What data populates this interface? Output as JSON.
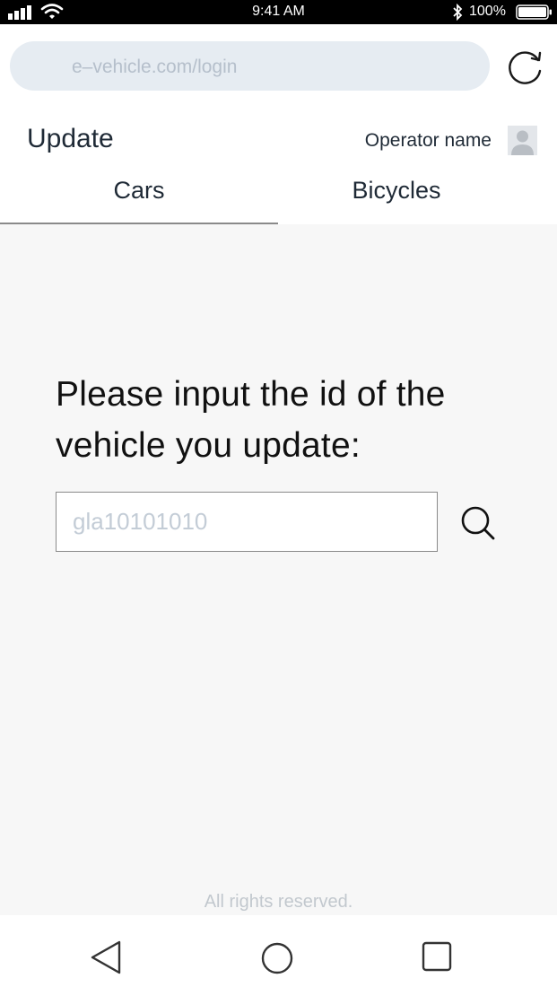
{
  "status_bar": {
    "time": "9:41 AM",
    "battery_percent": "100%",
    "icons": [
      "signal-icon",
      "wifi-icon",
      "bluetooth-icon",
      "battery-icon"
    ]
  },
  "browser": {
    "url": "e–vehicle.com/login",
    "reload_icon": "reload-icon"
  },
  "header": {
    "title": "Update",
    "operator_name": "Operator name",
    "avatar_icon": "user-avatar-icon"
  },
  "tabs": [
    {
      "label": "Cars",
      "active": true
    },
    {
      "label": "Bicycles",
      "active": false
    }
  ],
  "main": {
    "prompt": "Please input the id of the vehicle you update:",
    "vehicle_id_input": {
      "value": "",
      "placeholder": "gla10101010"
    },
    "search_icon": "search-icon",
    "footer": "All rights reserved."
  },
  "nav_bar": {
    "icons": [
      "back-icon",
      "home-icon",
      "recent-apps-icon"
    ]
  },
  "colors": {
    "status_bar": "#000000",
    "address_bar": "#e6ecf2",
    "main_background": "#f7f7f7",
    "active_tab_underline": "#8a8a8a",
    "placeholder": "#c3ccd6"
  }
}
